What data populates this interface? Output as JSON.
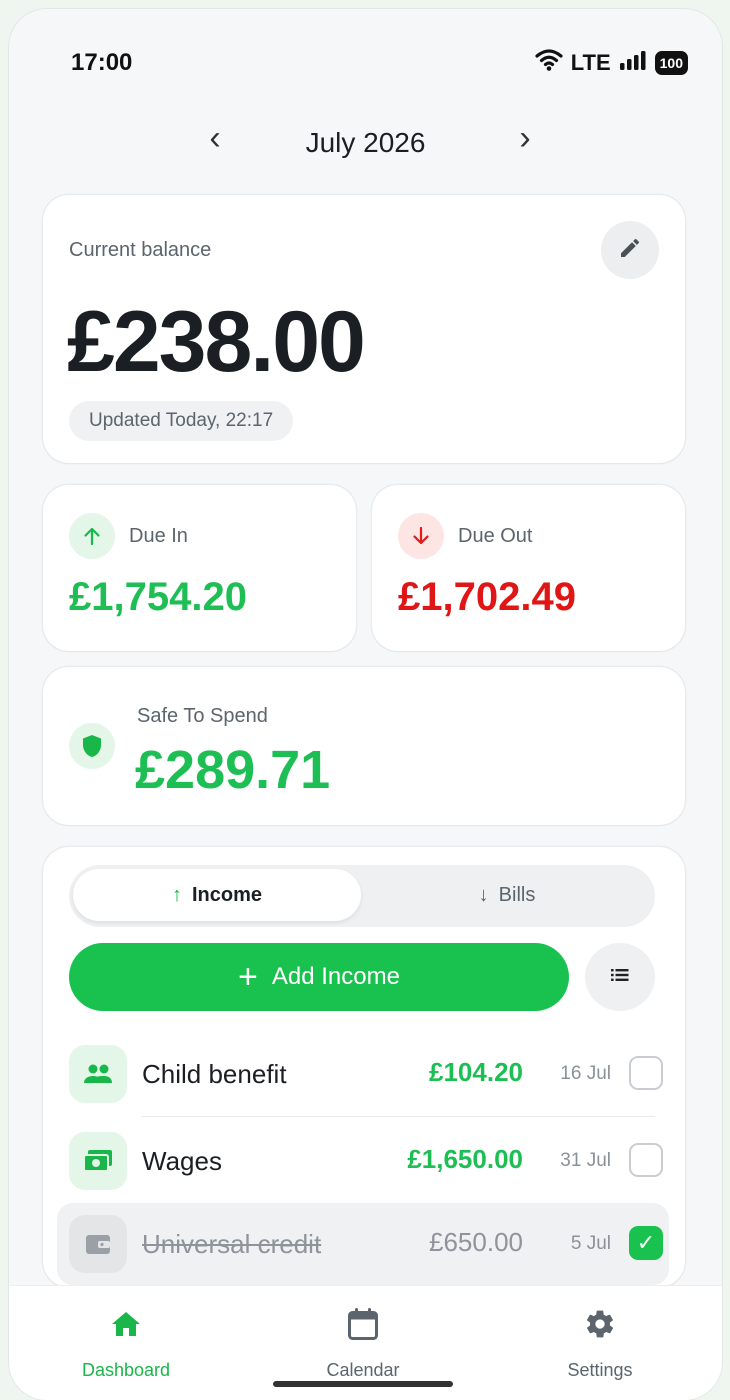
{
  "status_bar": {
    "time": "17:00",
    "network": "LTE",
    "battery": "100"
  },
  "month_nav": {
    "month": "July 2026",
    "prev_icon": "chevron-left-icon",
    "next_icon": "chevron-right-icon"
  },
  "balance": {
    "label": "Current balance",
    "amount": "£238.00",
    "updated": "Updated Today, 22:17",
    "edit_icon": "pencil-icon"
  },
  "due_in": {
    "label": "Due In",
    "amount": "£1,754.20",
    "color": "#1dbf54"
  },
  "due_out": {
    "label": "Due Out",
    "amount": "£1,702.49",
    "color": "#e01616"
  },
  "safe_to_spend": {
    "label": "Safe To Spend",
    "amount": "£289.71",
    "icon": "shield-icon"
  },
  "tabs": {
    "income": "Income",
    "bills": "Bills",
    "active": "income"
  },
  "add_button": {
    "label": "Add Income"
  },
  "items": [
    {
      "name": "Child benefit",
      "amount": "£104.20",
      "date": "16 Jul",
      "checked": false,
      "icon": "people-icon"
    },
    {
      "name": "Wages",
      "amount": "£1,650.00",
      "date": "31 Jul",
      "checked": false,
      "icon": "cash-icon"
    },
    {
      "name": "Universal credit",
      "amount": "£650.00",
      "date": "5 Jul",
      "checked": true,
      "icon": "wallet-icon"
    }
  ],
  "bottom_nav": {
    "items": [
      {
        "label": "Dashboard",
        "icon": "home-icon",
        "active": true
      },
      {
        "label": "Calendar",
        "icon": "calendar-icon",
        "active": false
      },
      {
        "label": "Settings",
        "icon": "gear-icon",
        "active": false
      }
    ]
  },
  "colors": {
    "accent": "#19c24e",
    "danger": "#e01616",
    "background": "#f6f7f8"
  }
}
